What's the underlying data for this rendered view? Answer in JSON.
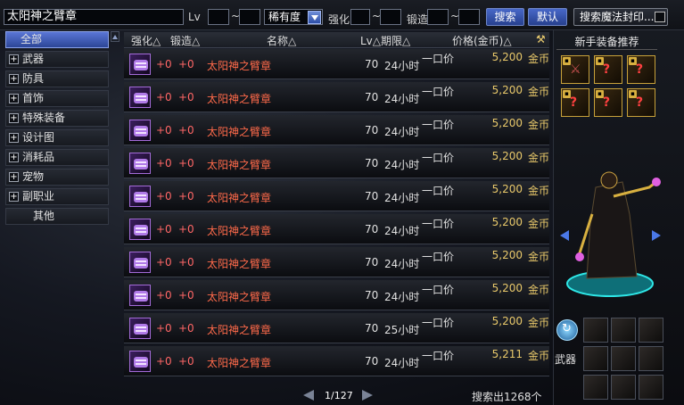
{
  "search": {
    "query": "太阳神之臂章",
    "lv_label": "Lv",
    "lv_min": "",
    "lv_max": "",
    "tilde": "~",
    "rarity": "稀有度",
    "strengthen_label": "强化",
    "str_min": "",
    "str_max": "",
    "forge_label": "锻造",
    "forge_min": "",
    "forge_max": "",
    "search_button": "搜索",
    "default_button": "默认",
    "magic_seal_button": "搜索魔法封印..."
  },
  "categories": [
    {
      "label": "全部",
      "selected": true,
      "expandable": false
    },
    {
      "label": "武器",
      "selected": false,
      "expandable": true
    },
    {
      "label": "防具",
      "selected": false,
      "expandable": true
    },
    {
      "label": "首饰",
      "selected": false,
      "expandable": true
    },
    {
      "label": "特殊装备",
      "selected": false,
      "expandable": true
    },
    {
      "label": "设计图",
      "selected": false,
      "expandable": true
    },
    {
      "label": "消耗品",
      "selected": false,
      "expandable": true
    },
    {
      "label": "宠物",
      "selected": false,
      "expandable": true
    },
    {
      "label": "副职业",
      "selected": false,
      "expandable": true
    },
    {
      "label": "其他",
      "selected": false,
      "expandable": false
    }
  ],
  "table": {
    "headers": {
      "strengthen": "强化△",
      "forge": "锻造△",
      "name": "名称△",
      "lv_period": "Lv△期限△",
      "price": "价格(金币)△"
    },
    "rows": [
      {
        "str": "+0",
        "forge": "+0",
        "name": "太阳神之臂章",
        "lv": "70",
        "time": "24小时",
        "type": "一口价",
        "price": "5,200",
        "unit": "金币"
      },
      {
        "str": "+0",
        "forge": "+0",
        "name": "太阳神之臂章",
        "lv": "70",
        "time": "24小时",
        "type": "一口价",
        "price": "5,200",
        "unit": "金币"
      },
      {
        "str": "+0",
        "forge": "+0",
        "name": "太阳神之臂章",
        "lv": "70",
        "time": "24小时",
        "type": "一口价",
        "price": "5,200",
        "unit": "金币"
      },
      {
        "str": "+0",
        "forge": "+0",
        "name": "太阳神之臂章",
        "lv": "70",
        "time": "24小时",
        "type": "一口价",
        "price": "5,200",
        "unit": "金币"
      },
      {
        "str": "+0",
        "forge": "+0",
        "name": "太阳神之臂章",
        "lv": "70",
        "time": "24小时",
        "type": "一口价",
        "price": "5,200",
        "unit": "金币"
      },
      {
        "str": "+0",
        "forge": "+0",
        "name": "太阳神之臂章",
        "lv": "70",
        "time": "24小时",
        "type": "一口价",
        "price": "5,200",
        "unit": "金币"
      },
      {
        "str": "+0",
        "forge": "+0",
        "name": "太阳神之臂章",
        "lv": "70",
        "time": "24小时",
        "type": "一口价",
        "price": "5,200",
        "unit": "金币"
      },
      {
        "str": "+0",
        "forge": "+0",
        "name": "太阳神之臂章",
        "lv": "70",
        "time": "24小时",
        "type": "一口价",
        "price": "5,200",
        "unit": "金币"
      },
      {
        "str": "+0",
        "forge": "+0",
        "name": "太阳神之臂章",
        "lv": "70",
        "time": "25小时",
        "type": "一口价",
        "price": "5,200",
        "unit": "金币"
      },
      {
        "str": "+0",
        "forge": "+0",
        "name": "太阳神之臂章",
        "lv": "70",
        "time": "24小时",
        "type": "一口价",
        "price": "5,211",
        "unit": "金币"
      }
    ]
  },
  "pagination": {
    "text": "1/127"
  },
  "result_count": "搜索出1268个",
  "right_panel": {
    "title": "新手装备推荐",
    "weapon_label": "武器"
  },
  "colors": {
    "accent_blue": "#3a5bc0",
    "item_name": "#ff6a4a",
    "price_gold": "#e8c86a",
    "enhance_red": "#ff6666"
  }
}
